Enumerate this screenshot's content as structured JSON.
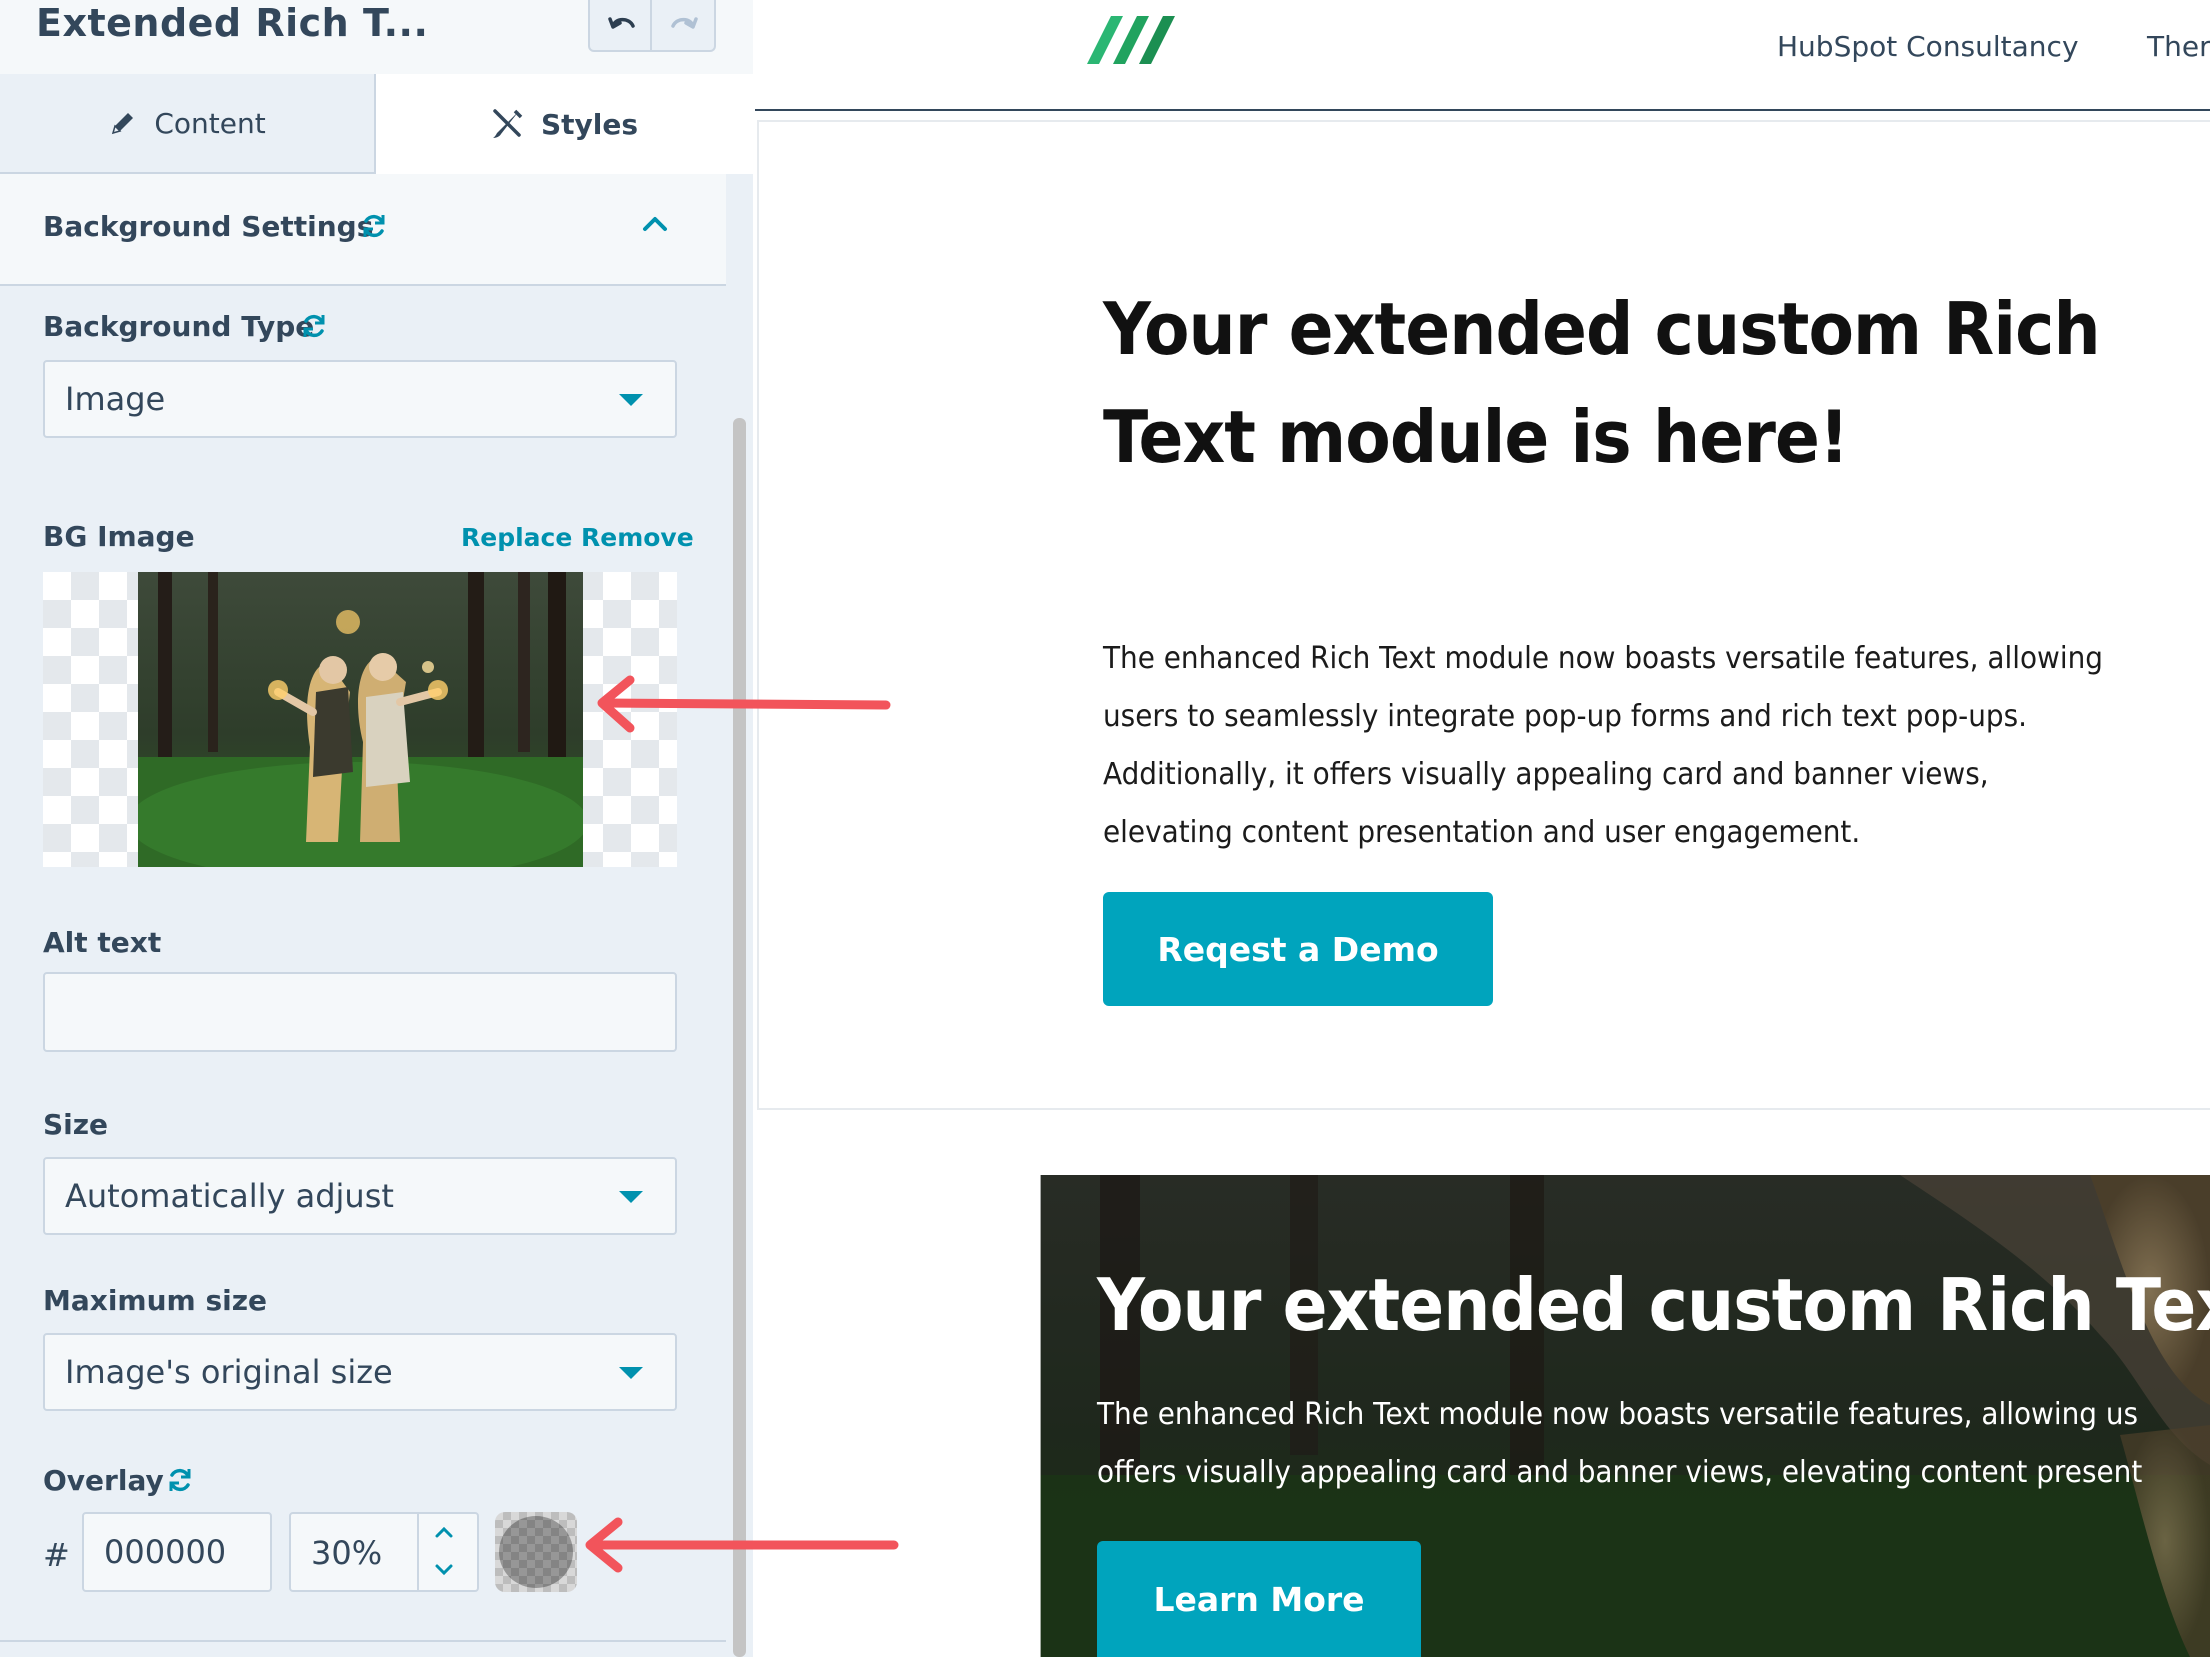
{
  "editor": {
    "module_title": "Extended Rich T...",
    "tabs": [
      {
        "label": "Content",
        "icon": "pencil-icon"
      },
      {
        "label": "Styles",
        "icon": "paintbrush-icon"
      }
    ],
    "section": {
      "title": "Background Settings",
      "icon": "refresh-icon",
      "expanded_icon": "chevron-up-icon"
    },
    "background_type": {
      "label": "Background Type",
      "value": "Image"
    },
    "bg_image": {
      "label": "BG Image",
      "replace": "Replace",
      "remove": "Remove"
    },
    "alt_text": {
      "label": "Alt text",
      "value": ""
    },
    "size": {
      "label": "Size",
      "value": "Automatically adjust"
    },
    "max_size": {
      "label": "Maximum size",
      "value": "Image's original size"
    },
    "overlay": {
      "label": "Overlay",
      "hash": "#",
      "color": "000000",
      "opacity": "30%"
    }
  },
  "preview": {
    "nav": [
      "HubSpot Consultancy",
      "Ther"
    ],
    "section1": {
      "heading_line1": "Your extended custom Rich",
      "heading_line2": "Text module is here!",
      "body": "The enhanced Rich Text module now boasts versatile features, allowing users to seamlessly integrate pop-up forms and rich text pop-ups. Additionally, it offers visually appealing card and banner views, elevating content presentation and user engagement.",
      "button": "Reqest a Demo"
    },
    "banner": {
      "heading": "Your extended custom Rich Text",
      "body_line1": "The enhanced Rich Text module now boasts versatile features, allowing us",
      "body_line2": "offers visually appealing card and banner views, elevating content present",
      "button": "Learn More"
    }
  },
  "colors": {
    "accent": "#00a4bd",
    "arrow": "#f2545b",
    "logo": "#2bb673"
  }
}
